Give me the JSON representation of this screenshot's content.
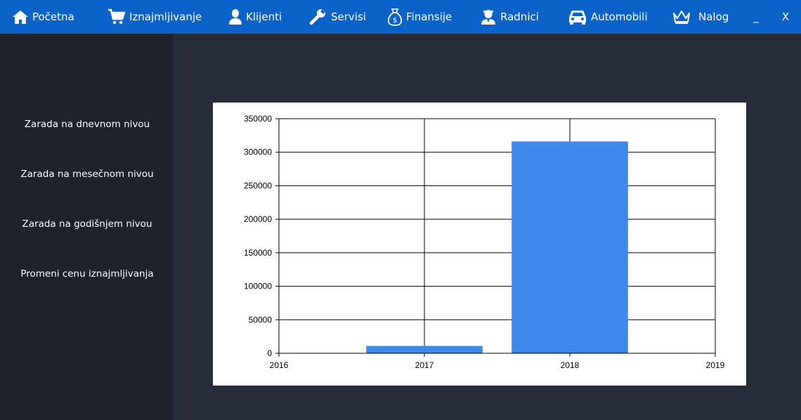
{
  "nav": {
    "items": [
      {
        "label": "Početna",
        "icon": "home-icon"
      },
      {
        "label": "Iznajmljivanje",
        "icon": "cart-icon"
      },
      {
        "label": "Klijenti",
        "icon": "user-icon"
      },
      {
        "label": "Servisi",
        "icon": "wrench-icon"
      },
      {
        "label": "Finansije",
        "icon": "money-bag-icon"
      },
      {
        "label": "Radnici",
        "icon": "worker-icon"
      },
      {
        "label": "Automobili",
        "icon": "car-icon"
      },
      {
        "label": "Nalog",
        "icon": "crown-icon"
      }
    ],
    "minimize_label": "_",
    "close_label": "X"
  },
  "sidebar": {
    "items": [
      {
        "label": "Zarada na dnevnom nivou"
      },
      {
        "label": "Zarada na mesečnom nivou"
      },
      {
        "label": "Zarada na godišnjem nivou"
      },
      {
        "label": "Promeni cenu iznajmljivanja"
      }
    ]
  },
  "colors": {
    "nav_bg": "#0b63c9",
    "sidebar_bg": "#1d222b",
    "main_bg": "#252d3a",
    "bar": "#3d88eb"
  },
  "chart_data": {
    "type": "bar",
    "categories": [
      "2017",
      "2018"
    ],
    "x": [
      2017,
      2018
    ],
    "values": [
      11000,
      316000
    ],
    "xlim": [
      2016,
      2019
    ],
    "xticks": [
      "2016",
      "2017",
      "2018",
      "2019"
    ],
    "ylim": [
      0,
      350000
    ],
    "yticks": [
      "0",
      "50000",
      "100000",
      "150000",
      "200000",
      "250000",
      "300000",
      "350000"
    ],
    "title": "",
    "xlabel": "",
    "ylabel": "",
    "grid": true,
    "legend": "none"
  }
}
